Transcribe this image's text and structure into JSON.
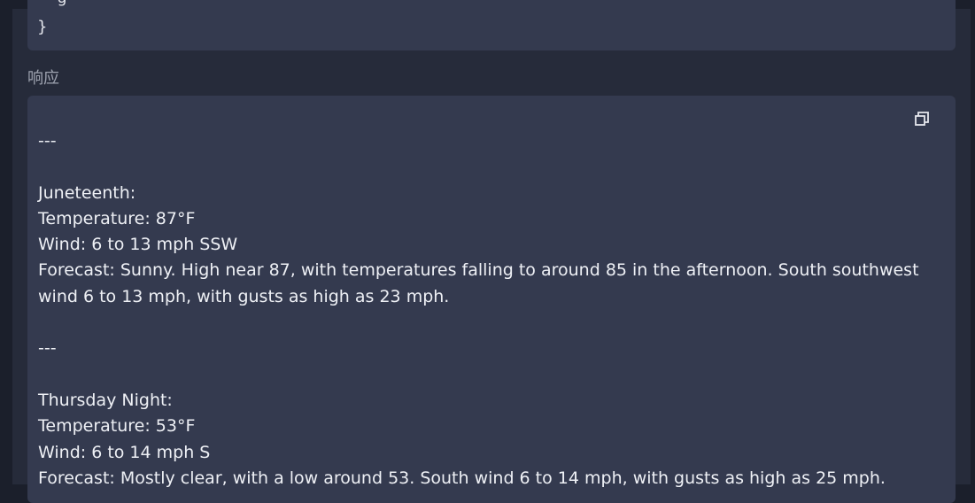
{
  "request": {
    "tail_fragment": "    g",
    "closing_brace": "}"
  },
  "response": {
    "label": "响应",
    "copy_icon": "copy-icon",
    "body": "---\n\nJuneteenth:\nTemperature: 87°F\nWind: 6 to 13 mph SSW\nForecast: Sunny. High near 87, with temperatures falling to around 85 in the afternoon. South southwest wind 6 to 13 mph, with gusts as high as 23 mph.\n\n---\n\nThursday Night:\nTemperature: 53°F\nWind: 6 to 14 mph S\nForecast: Mostly clear, with a low around 53. South wind 6 to 14 mph, with gusts as high as 25 mph."
  },
  "colors": {
    "page_background": "#1b1f2b",
    "panel_background": "#262b3a",
    "code_block_background": "#343a4f",
    "text": "#eef0f5",
    "muted_label": "#9ea3b0"
  }
}
